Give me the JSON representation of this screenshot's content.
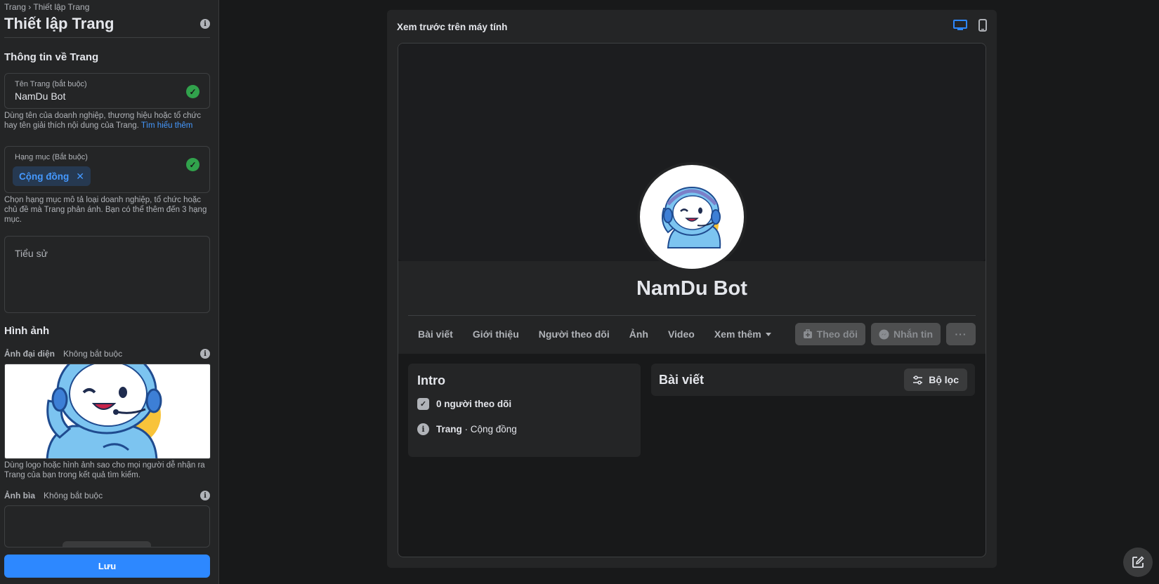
{
  "breadcrumb": {
    "root": "Trang",
    "sep": " › ",
    "current": "Thiết lập Trang"
  },
  "page_title": "Thiết lập Trang",
  "page_info": {
    "section_title": "Thông tin về Trang",
    "name_field": {
      "label": "Tên Trang (bắt buộc)",
      "value": "NamDu Bot"
    },
    "name_help": "Dùng tên của doanh nghiệp, thương hiệu hoặc tổ chức hay tên giải thích nội dung của Trang.",
    "name_help_link": "Tìm hiểu thêm",
    "category_field": {
      "label": "Hạng mục (Bắt buộc)",
      "chip": "Cộng đồng"
    },
    "category_help": "Chọn hạng mục mô tả loại doanh nghiệp, tổ chức hoặc chủ đề mà Trang phản ánh. Bạn có thể thêm đến 3 hạng mục.",
    "bio_placeholder": "Tiểu sử"
  },
  "images": {
    "section_title": "Hình ảnh",
    "avatar_label": "Ảnh đại diện",
    "avatar_optional": "Không bắt buộc",
    "avatar_help": "Dùng logo hoặc hình ảnh sao cho mọi người dễ nhận ra Trang của bạn trong kết quả tìm kiếm.",
    "cover_label": "Ảnh bìa",
    "cover_optional": "Không bắt buộc"
  },
  "save_button": "Lưu",
  "preview": {
    "title": "Xem trước trên máy tính",
    "page_name": "NamDu Bot",
    "tabs": [
      "Bài viết",
      "Giới thiệu",
      "Người theo dõi",
      "Ảnh",
      "Video",
      "Xem thêm"
    ],
    "follow_button": "Theo dõi",
    "message_button": "Nhắn tin",
    "more_button": "···",
    "intro": {
      "title": "Intro",
      "followers": "0 người theo dõi",
      "type_bold": "Trang",
      "type_rest": " · Cộng đồng"
    },
    "posts": {
      "title": "Bài viết",
      "filter_button": "Bộ lọc"
    }
  },
  "colors": {
    "accent": "#2d88ff",
    "link": "#4599ff",
    "success": "#31a24c",
    "panel": "#242526",
    "background": "#18191a"
  },
  "icons": [
    "info-icon",
    "check-icon",
    "close-icon",
    "desktop-icon",
    "mobile-icon",
    "follow-icon",
    "messenger-icon",
    "filter-icon",
    "compose-icon"
  ]
}
